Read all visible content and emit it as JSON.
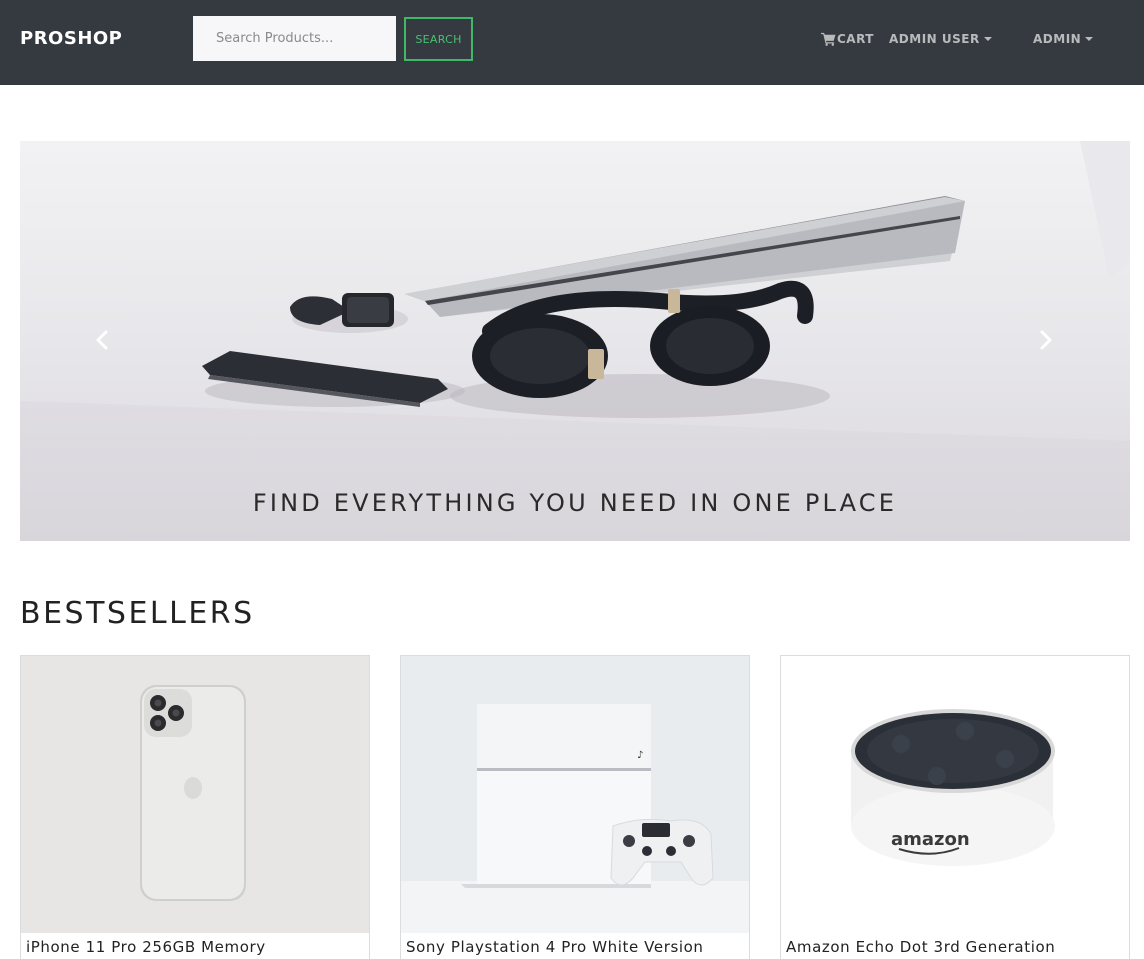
{
  "navbar": {
    "brand": "PROSHOP",
    "search": {
      "placeholder": "Search Products...",
      "value": ""
    },
    "search_button": "SEARCH",
    "cart_label": "CART",
    "admin_user_label": "ADMIN USER",
    "admin_label": "ADMIN"
  },
  "carousel": {
    "caption": "FIND EVERYTHING YOU NEED IN ONE PLACE"
  },
  "bestsellers": {
    "title": "BESTSELLERS",
    "products": [
      {
        "name": "iPhone 11 Pro 256GB Memory"
      },
      {
        "name": "Sony Playstation 4 Pro White Version"
      },
      {
        "name": "Amazon Echo Dot 3rd Generation"
      }
    ]
  },
  "colors": {
    "navbar_bg": "#343a40",
    "accent_green": "#4bbf73",
    "page_bg": "#ffffff"
  },
  "icons": [
    "shopping-cart-icon",
    "caret-down-icon",
    "chevron-left-icon",
    "chevron-right-icon"
  ]
}
